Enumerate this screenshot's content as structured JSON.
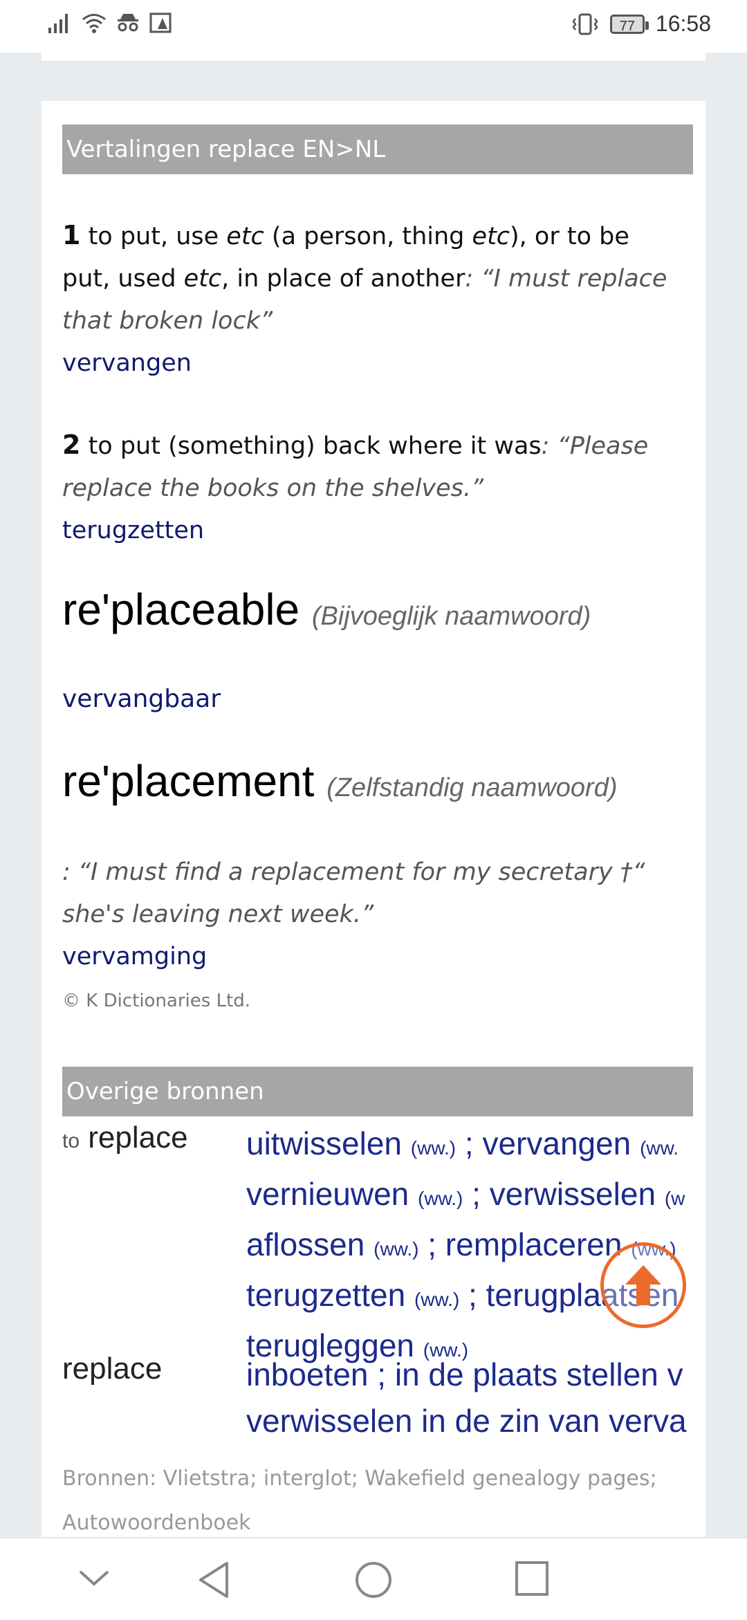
{
  "status_bar": {
    "time": "16:58",
    "battery": "77",
    "icons": [
      "signal-icon",
      "wifi-icon",
      "incognito-icon",
      "image-alert-icon",
      "vibrate-icon"
    ]
  },
  "translations": {
    "header": "Vertalingen replace EN>NL",
    "meaning1": {
      "num": "1",
      "t1": " to put, use ",
      "etc1": "etc",
      "t2": " (a person, thing ",
      "etc2": "etc",
      "t3": "), or to be put, used ",
      "etc3": "etc",
      "t4": ", in place of another",
      "example": ": “I must replace that broken lock”",
      "translation": "vervangen"
    },
    "meaning2": {
      "num": "2",
      "text": " to put (something) back where it was",
      "example": ": “Please replace the books on the shelves.”",
      "translation": "terugzetten"
    },
    "entry2": {
      "word": "re'placeable",
      "pos": "(Bijvoeglijk naamwoord)",
      "translation": "vervangbaar"
    },
    "entry3": {
      "word": "re'placement",
      "pos": "(Zelfstandig naamwoord)",
      "example": ": “I must find a replacement for my secretary †“ she's leaving next week.”",
      "translation": "vervamging"
    },
    "copyright": "© K Dictionaries Ltd."
  },
  "other_sources": {
    "header": "Overige bronnen",
    "row1": {
      "to": "to",
      "term": "replace",
      "lines": [
        [
          {
            "w": "uitwisselen",
            "t": "(ww.)"
          },
          {
            "w": "vervangen",
            "t": "(ww."
          }
        ],
        [
          {
            "w": "vernieuwen",
            "t": "(ww.)"
          },
          {
            "w": "verwisselen",
            "t": "(w"
          }
        ],
        [
          {
            "w": "aflossen",
            "t": "(ww.)"
          },
          {
            "w": "remplaceren",
            "t": "(ww.)"
          }
        ],
        [
          {
            "w": "terugzetten",
            "t": "(ww.)"
          },
          {
            "w": "terugplaatsen",
            "t": ""
          }
        ],
        [
          {
            "w": "terugleggen",
            "t": "(ww.)"
          }
        ]
      ]
    },
    "row2": {
      "term": "replace",
      "line1a": "inboeten",
      "line1b": "in de plaats stellen v",
      "line2": "verwisselen in de zin van verva"
    },
    "note_line1": "Bronnen: Vlietstra; interglot; Wakefield genealogy pages;",
    "note_line2": "Autowoordenboek"
  },
  "colors": {
    "link": "#0f1a6e",
    "header_bg": "#a6a6a6",
    "fab": "#ec6a2a"
  },
  "nav": [
    "chevron-down-icon",
    "back-icon",
    "home-icon",
    "recents-icon"
  ]
}
